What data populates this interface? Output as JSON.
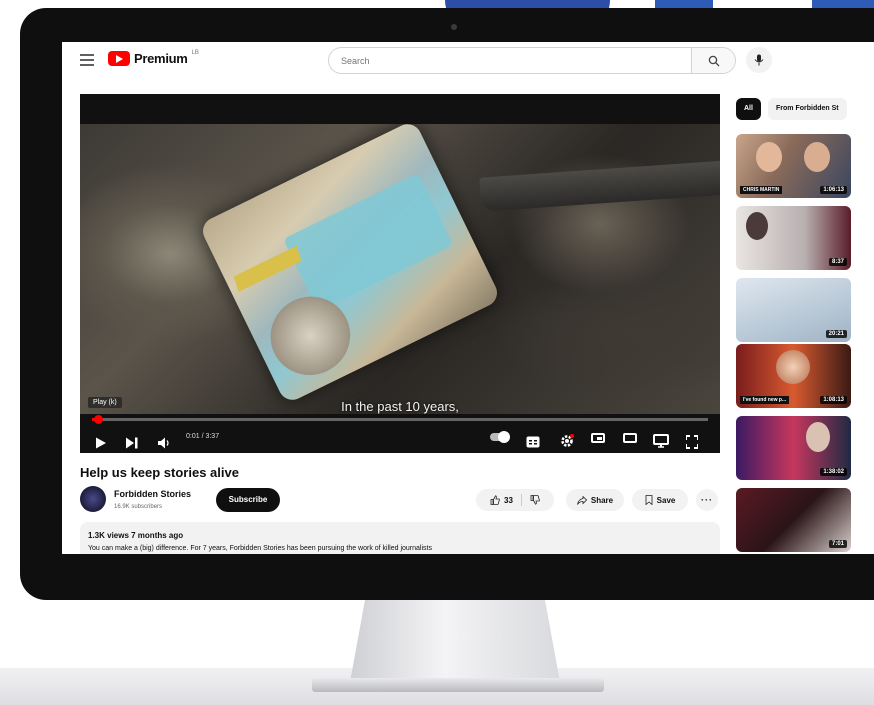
{
  "header": {
    "logo_text": "Premium",
    "logo_sup": "LB",
    "search_placeholder": "Search"
  },
  "player": {
    "subtitle": "In the past 10 years,",
    "tooltip": "Play (k)",
    "time": "0:01 / 3:37",
    "progress": 0.01
  },
  "video": {
    "title": "Help us keep stories alive",
    "channel": "Forbidden Stories",
    "subscribers": "16.9K subscribers",
    "subscribe_label": "Subscribe",
    "likes": "33",
    "share_label": "Share",
    "save_label": "Save",
    "views_meta": "1.3K views  7 months ago",
    "description": "You can make a (big) difference. For 7 years, Forbidden Stories has been pursuing the work of killed journalists"
  },
  "sidebar": {
    "chips": [
      "All",
      "From Forbidden St"
    ],
    "thumbnails": [
      {
        "duration": "1:06:13",
        "caption": "CHRIS MARTIN"
      },
      {
        "duration": "8:37",
        "caption": ""
      },
      {
        "duration": "20:21",
        "caption": ""
      },
      {
        "duration": "1:08:13",
        "caption": "I've found new p..."
      },
      {
        "duration": "1:38:02",
        "caption": ""
      },
      {
        "duration": "7:01",
        "caption": ""
      }
    ]
  },
  "colors": {
    "brand_red": "#ff0000",
    "bezel": "#0f0f10",
    "backdrop_blue": "#2b4fa8"
  }
}
